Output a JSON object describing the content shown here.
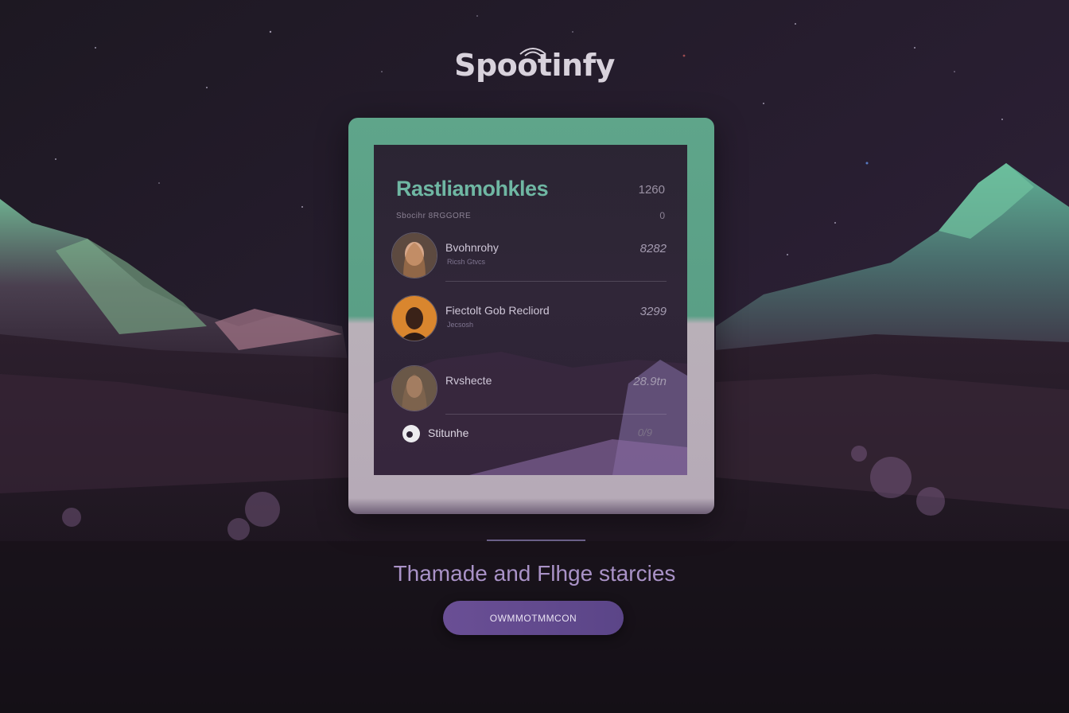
{
  "app": {
    "logo_text": "Spootinfy"
  },
  "card": {
    "title": "Rastliamohkles",
    "count": "1260",
    "subtitle": "Sbocihr 8RGGORE",
    "subtitle_value": "0",
    "items": [
      {
        "name": "Bvohnrohy",
        "sub": "Ricsh Gtvcs",
        "value": "8282"
      },
      {
        "name": "Fiectolt Gob  Recliord",
        "sub": "Jecsosh",
        "value": "3299"
      },
      {
        "name": "Rvshecte",
        "sub": "",
        "value": "28.9tn"
      }
    ],
    "mini_item": {
      "name": "Stitunhe",
      "value": "0/9"
    }
  },
  "tagline": "Thamade and Flhge starcies",
  "cta": {
    "label": "OWMMOTMMCON"
  },
  "colors": {
    "accent_green": "#5fa58a",
    "accent_purple": "#6a4f95",
    "background": "#1a1420"
  },
  "icons": {
    "logo_waves": "wifi-waves-icon",
    "mini_item": "vinyl-icon"
  }
}
